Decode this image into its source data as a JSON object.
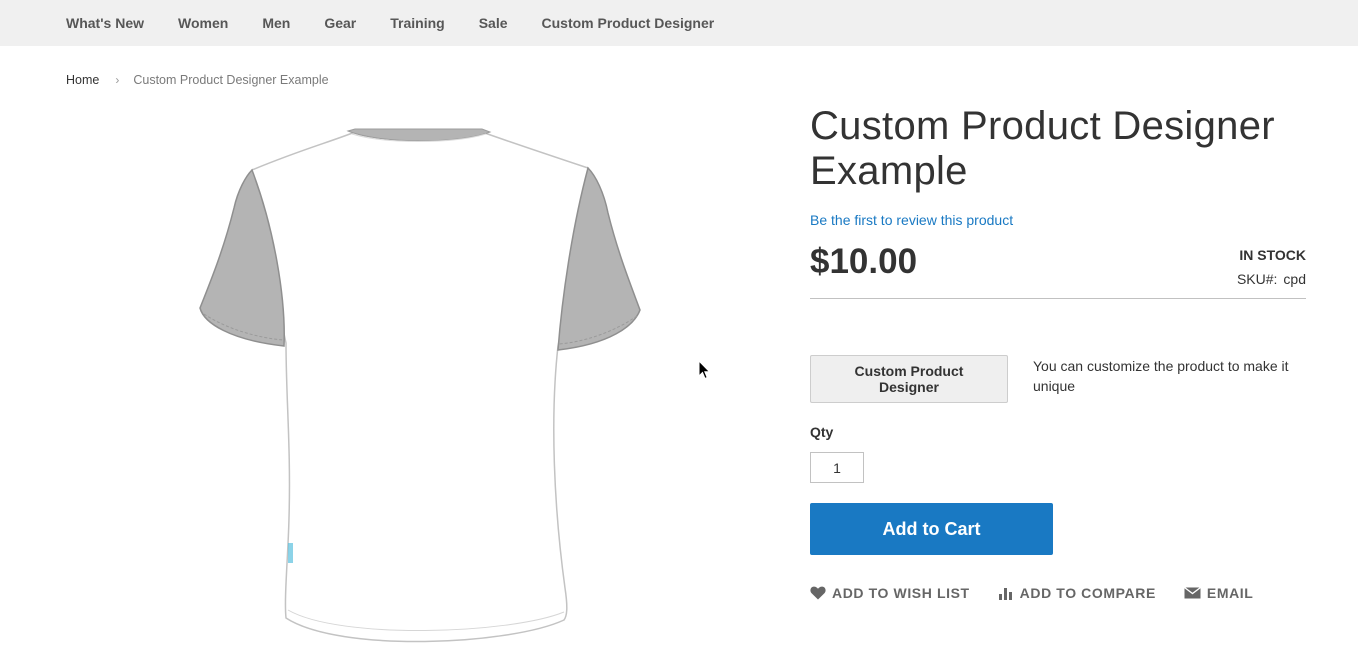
{
  "nav": {
    "items": [
      "What's New",
      "Women",
      "Men",
      "Gear",
      "Training",
      "Sale",
      "Custom Product Designer"
    ]
  },
  "breadcrumb": {
    "home": "Home",
    "separator": "›",
    "current": "Custom Product Designer Example"
  },
  "product": {
    "title": "Custom Product Designer Example",
    "review_link": "Be the first to review this product",
    "price": "$10.00",
    "stock": "IN STOCK",
    "sku_label": "SKU#:",
    "sku_value": "cpd",
    "designer_button": "Custom Product Designer",
    "designer_note": "You can customize the product to make it unique",
    "qty_label": "Qty",
    "qty_value": "1",
    "add_to_cart": "Add to Cart"
  },
  "actions": {
    "wishlist": "ADD TO WISH LIST",
    "compare": "ADD TO COMPARE",
    "email": "EMAIL"
  },
  "colors": {
    "accent": "#1979c3",
    "nav_bg": "#f0f0f0",
    "sleeve": "#b4b4b4"
  },
  "icons": {
    "wishlist": "heart-icon",
    "compare": "bar-chart-icon",
    "email": "envelope-icon",
    "breadcrumb_separator": "chevron-right-icon"
  }
}
